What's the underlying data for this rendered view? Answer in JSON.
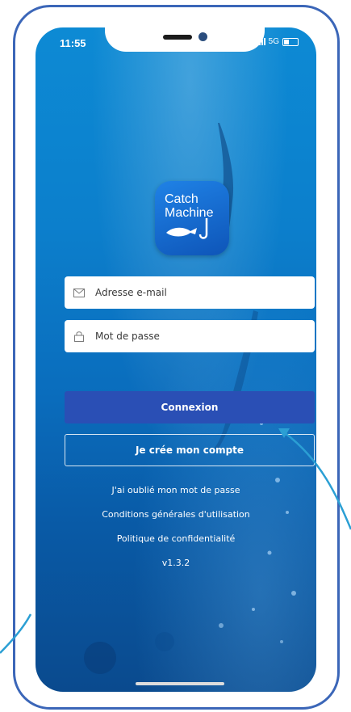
{
  "status_bar": {
    "time": "11:55",
    "network": "5G"
  },
  "app": {
    "logo_line1": "Catch",
    "logo_line2": "Machine"
  },
  "login_form": {
    "email_placeholder": "Adresse e-mail",
    "password_placeholder": "Mot de passe",
    "login_button": "Connexion",
    "register_button": "Je crée mon compte"
  },
  "links": {
    "forgot_password": "J'ai oublié mon mot de passe",
    "terms": "Conditions générales d'utilisation",
    "privacy": "Politique de confidentialité",
    "version": "v1.3.2"
  },
  "colors": {
    "accent": "#2a4fb5",
    "frame": "#3b66b8",
    "callout_arrow": "#2b9fd4"
  },
  "icons": {
    "email": "envelope-icon",
    "password": "lock-icon",
    "callout": "arrow-pointer"
  }
}
